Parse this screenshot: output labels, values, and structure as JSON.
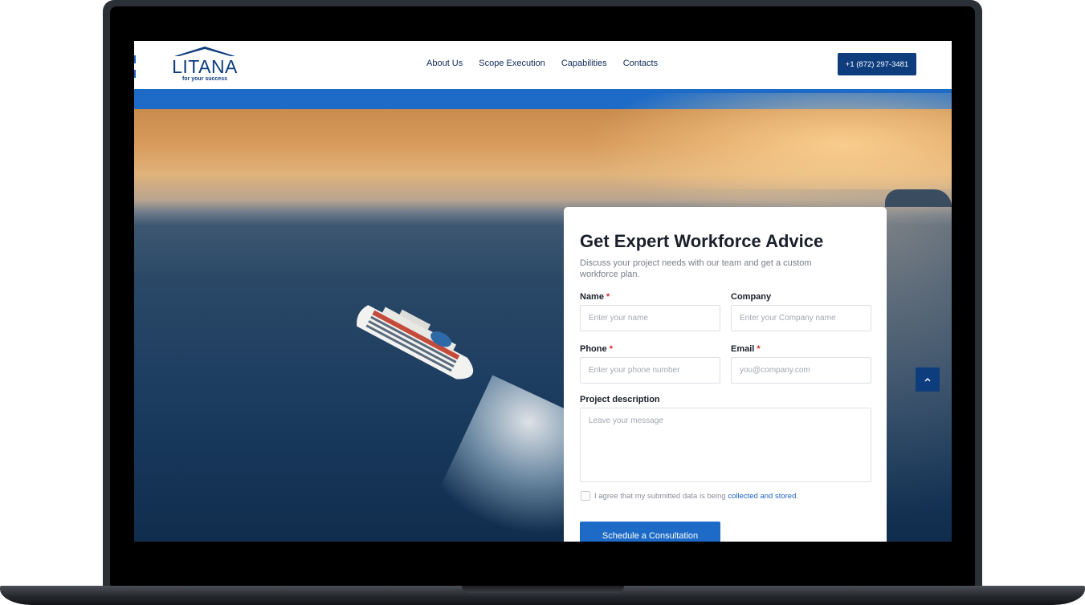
{
  "header": {
    "logo_text": "LITANA",
    "logo_tagline": "for your success",
    "nav": [
      "About Us",
      "Scope Execution",
      "Capabilities",
      "Contacts"
    ],
    "phone_label": "+1 (872) 297-3481"
  },
  "form": {
    "title": "Get Expert Workforce Advice",
    "subtitle": "Discuss your project needs with our team and get a custom workforce plan.",
    "fields": {
      "name": {
        "label": "Name",
        "placeholder": "Enter your name",
        "required_mark": "*"
      },
      "company": {
        "label": "Company",
        "placeholder": "Enter your Company name"
      },
      "phone": {
        "label": "Phone",
        "placeholder": "Enter your phone number",
        "required_mark": "*"
      },
      "email": {
        "label": "Email",
        "placeholder": "you@company.com",
        "required_mark": "*"
      },
      "description": {
        "label": "Project description",
        "placeholder": "Leave your message"
      }
    },
    "consent": {
      "text": "I agree that my submitted data is being ",
      "link": "collected and stored",
      "suffix": "."
    },
    "submit_label": "Schedule a Consultation"
  },
  "colors": {
    "brand_navy": "#0e3d7e",
    "brand_blue": "#1d6bc7",
    "required": "#d62b2b"
  },
  "icons": {
    "scroll_top": "chevron-up-icon",
    "logo": "roof-logo-icon"
  }
}
